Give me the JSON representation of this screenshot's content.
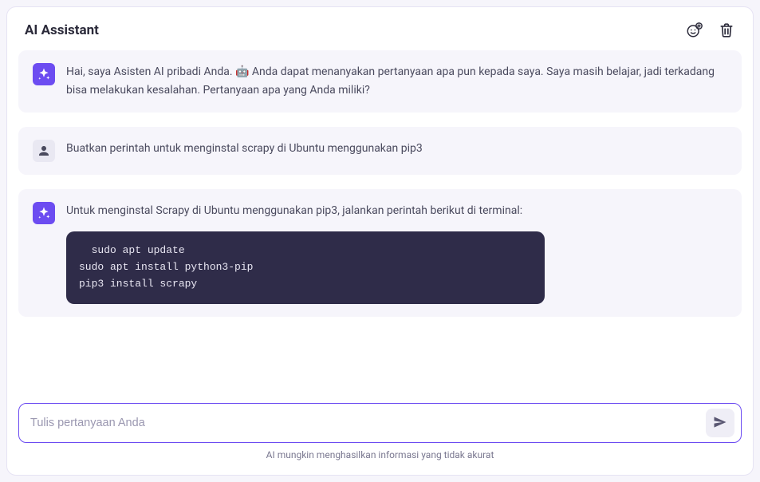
{
  "header": {
    "title": "AI Assistant"
  },
  "messages": [
    {
      "role": "ai",
      "text": "Hai, saya Asisten AI pribadi Anda. 🤖 Anda dapat menanyakan pertanyaan apa pun kepada saya. Saya masih belajar, jadi terkadang bisa melakukan kesalahan. Pertanyaan apa yang Anda miliki?"
    },
    {
      "role": "user",
      "text": "Buatkan perintah untuk menginstal scrapy di Ubuntu menggunakan pip3"
    },
    {
      "role": "ai",
      "text": "Untuk menginstal Scrapy di Ubuntu menggunakan pip3, jalankan perintah berikut di terminal:",
      "code": "  sudo apt update\nsudo apt install python3-pip\npip3 install scrapy"
    }
  ],
  "input": {
    "placeholder": "Tulis pertanyaan Anda",
    "value": ""
  },
  "disclaimer": "AI mungkin menghasilkan informasi yang tidak akurat"
}
